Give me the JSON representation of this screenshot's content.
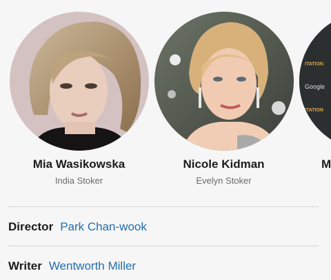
{
  "cast": [
    {
      "name": "Mia Wasikowska",
      "character": "India Stoker"
    },
    {
      "name": "Nicole Kidman",
      "character": "Evelyn Stoker"
    },
    {
      "name": "M",
      "character": ""
    }
  ],
  "partial_card_photo_text": {
    "line1": "ITATION",
    "line2": "Google",
    "line3": "ITATION"
  },
  "credits": [
    {
      "role": "Director",
      "person": "Park Chan-wook"
    },
    {
      "role": "Writer",
      "person": "Wentworth Miller"
    }
  ],
  "colors": {
    "background": "#f6f6f6",
    "link": "#1f6db0",
    "divider": "#d6d6d6"
  }
}
